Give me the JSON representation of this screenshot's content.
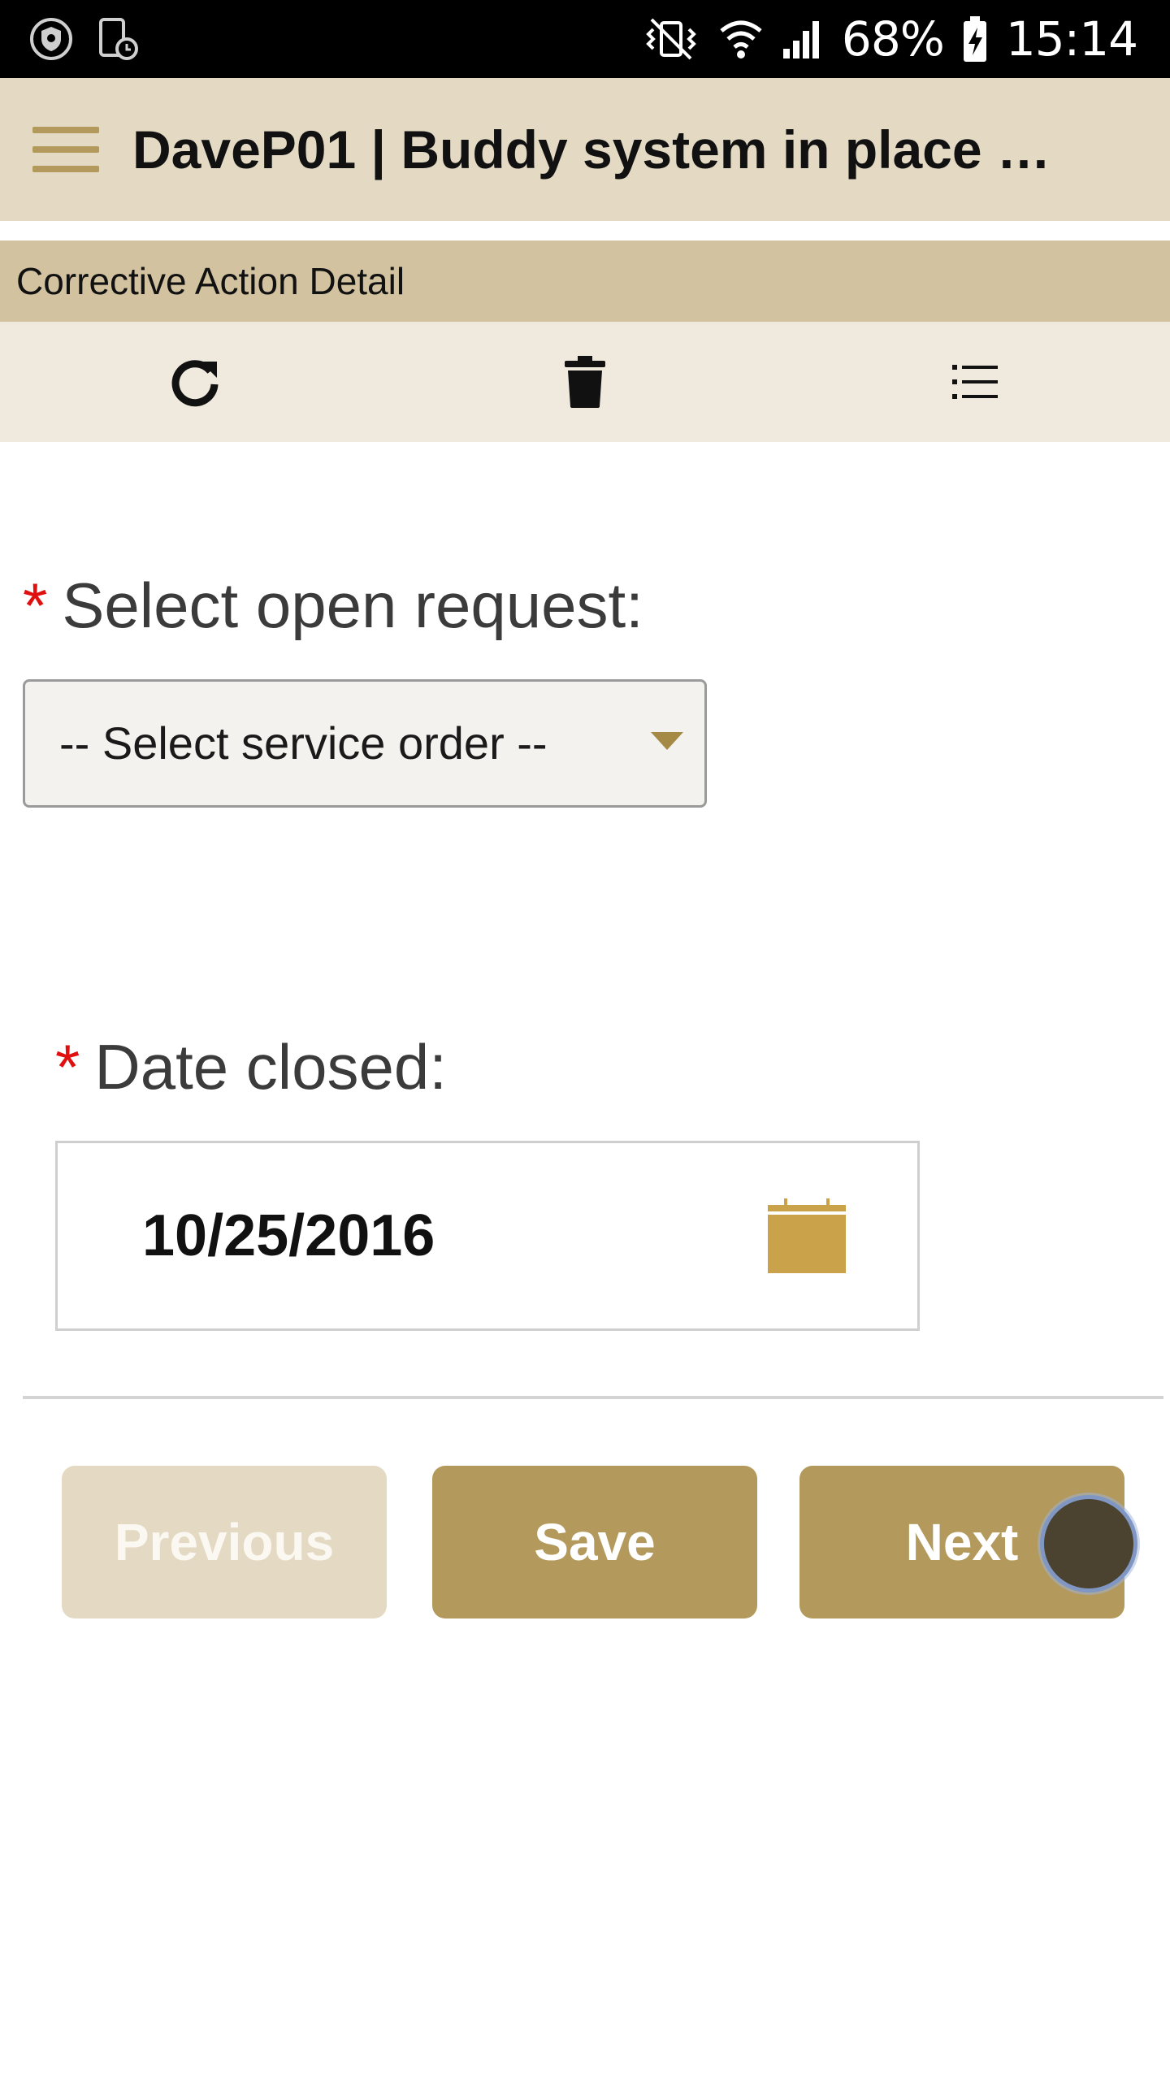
{
  "status_bar": {
    "battery_percent": "68%",
    "time": "15:14",
    "icons": [
      "shield-icon",
      "device-clock-icon",
      "vibrate-mute-icon",
      "wifi-icon",
      "signal-icon",
      "battery-charging-icon"
    ]
  },
  "app_bar": {
    "title": "DaveP01 | Buddy system in place a…",
    "menu_icon": "hamburger-icon"
  },
  "section": {
    "title": "Corrective Action Detail"
  },
  "toolbar": {
    "items": [
      "refresh-icon",
      "delete-icon",
      "list-icon"
    ]
  },
  "form": {
    "required_marker": "*",
    "open_request": {
      "label": "Select open request:",
      "selected": "-- Select service order --"
    },
    "date_closed": {
      "label": "Date closed:",
      "value": "10/25/2016",
      "icon": "calendar-icon"
    }
  },
  "buttons": {
    "previous": "Previous",
    "save": "Save",
    "next": "Next"
  },
  "colors": {
    "app_bar": "#e4dac4",
    "section_header": "#d2c2a0",
    "toolbar": "#f0e9dd",
    "accent": "#b39a5c",
    "calendar": "#c9a24a",
    "required": "#e01010",
    "disabled_button": "#e4d9c3"
  }
}
